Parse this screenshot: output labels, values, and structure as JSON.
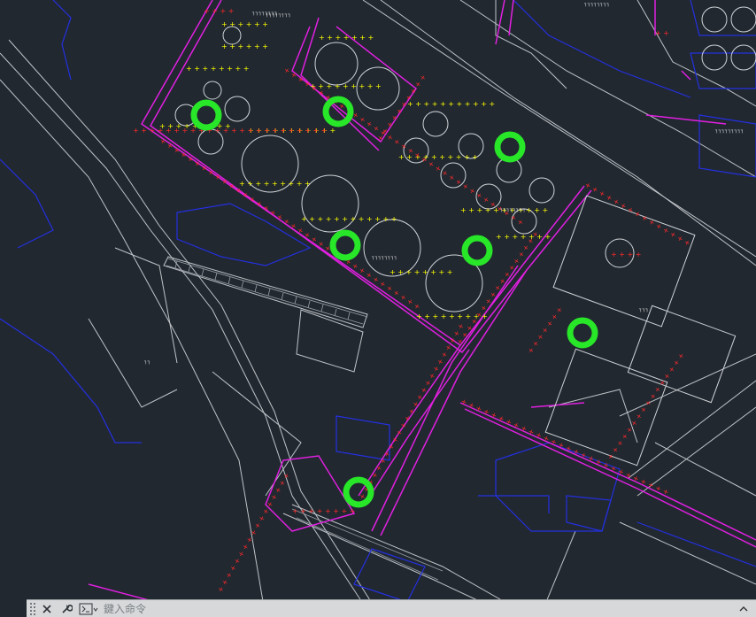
{
  "canvas": {
    "colors": {
      "background": "#212830",
      "yellow_markers": "#ffff00",
      "red_markers": "#ff2020",
      "magenta_lines": "#e020e0",
      "blue_lines": "#1e2ae0",
      "white_lines": "#c8c8c8",
      "green_highlight": "#28e628"
    },
    "labels": {
      "tank_label_a": "┐┐┐┐┐┐┐┐",
      "tank_label_b": "┐┐┐┐┐┐┐┐",
      "tank_label_c": "┐┐┐┐┐┐┐┐",
      "label_top": "┐┐┐┐┐┐┐┐",
      "label_top_right": "┐┐┐┐┐┐┐┐",
      "label_right": "┐┐┐",
      "label_right_2": "┐┐┐┐┐┐┐┐┐",
      "label_mid": "┐┐"
    }
  },
  "command_line": {
    "close_icon": "close-icon",
    "customize_icon": "wrench-icon",
    "prompt_icon": "command-prompt-icon",
    "placeholder": "鍵入命令"
  }
}
